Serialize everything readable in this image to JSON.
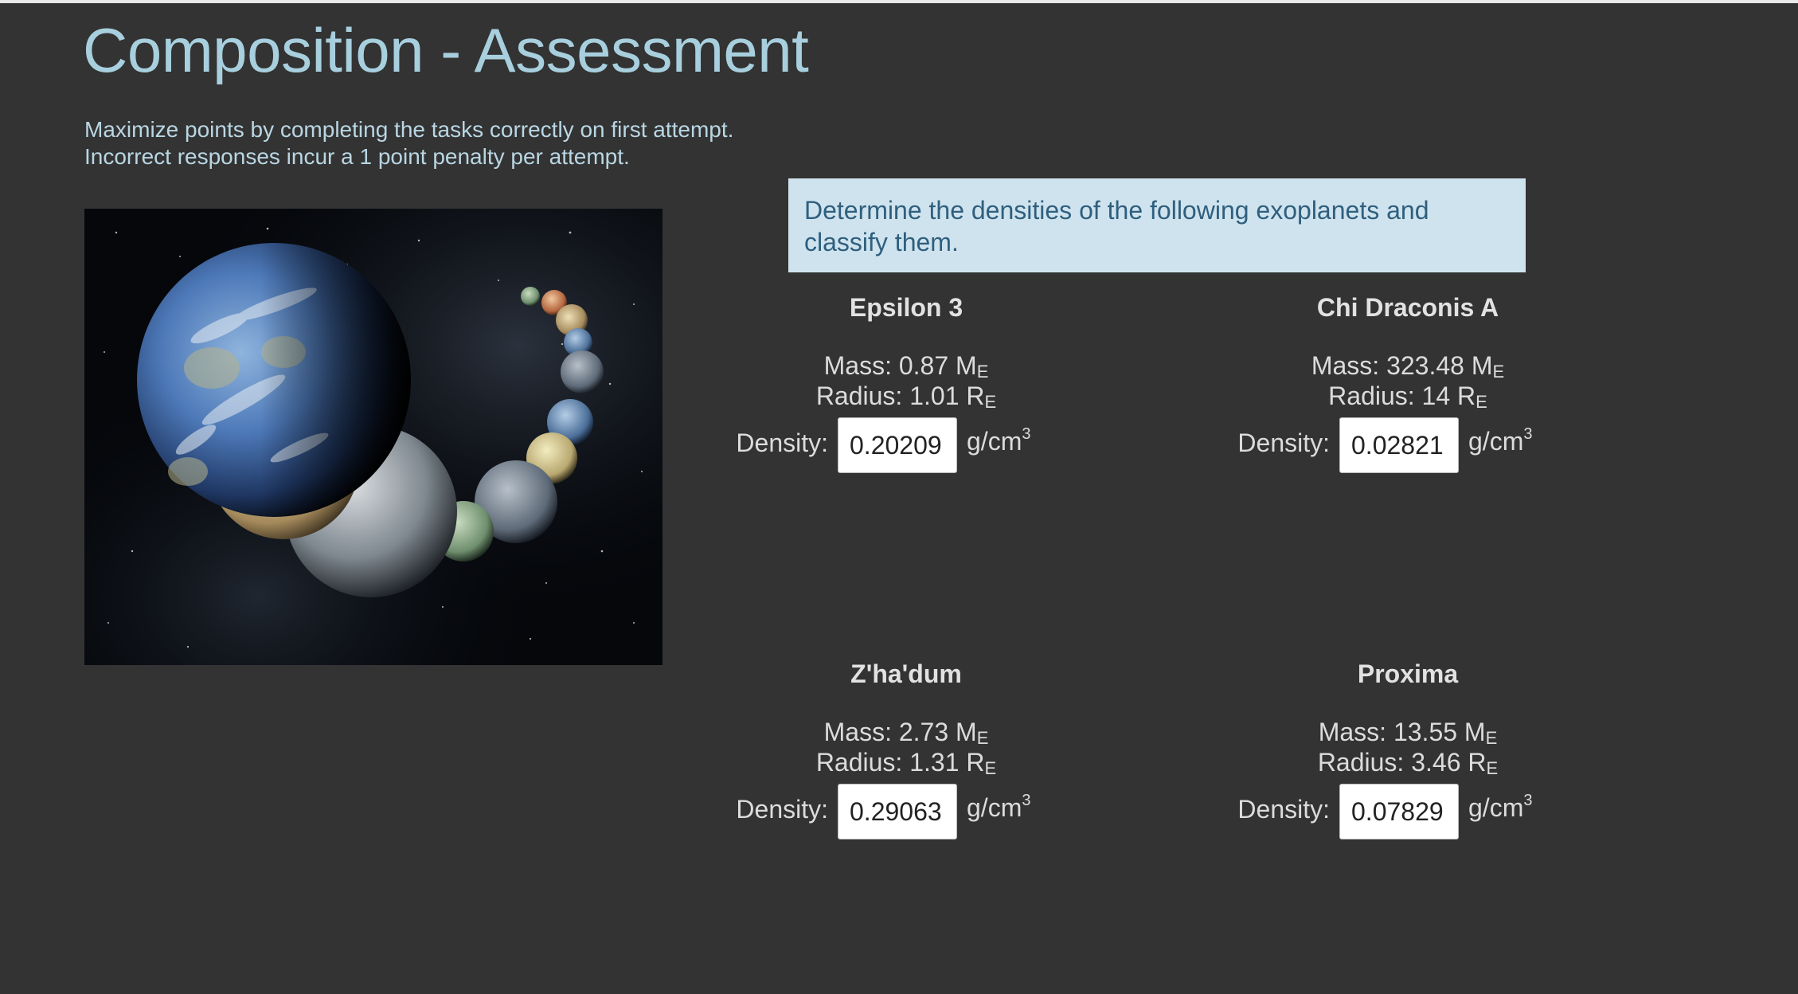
{
  "page": {
    "title": "Composition - Assessment",
    "instructions": [
      "Maximize points by completing the tasks correctly on first attempt.",
      "Incorrect responses incur a 1 point penalty per attempt."
    ]
  },
  "prompt": "Determine the densities of the following exoplanets and classify them.",
  "labels": {
    "mass": "Mass:",
    "radius": "Radius:",
    "density": "Density:",
    "unit_base": "g/cm",
    "unit_exp": "3",
    "mass_sub": "E",
    "radius_sub": "E",
    "mass_unit": "M",
    "radius_unit": "R"
  },
  "planets": [
    {
      "name": "Epsilon 3",
      "mass": "0.87",
      "radius": "1.01",
      "density_value": "0.20209"
    },
    {
      "name": "Chi Draconis A",
      "mass": "323.48",
      "radius": "14",
      "density_value": "0.02821"
    },
    {
      "name": "Z'ha'dum",
      "mass": "2.73",
      "radius": "1.31",
      "density_value": "0.29063"
    },
    {
      "name": "Proxima",
      "mass": "13.55",
      "radius": "3.46",
      "density_value": "0.07829"
    }
  ],
  "colors": {
    "background": "#333333",
    "title": "#a8cfde",
    "prompt_bg": "#cfe3ee",
    "prompt_text": "#2f5f7e"
  },
  "icons": {
    "hero_image": "exoplanet-lineup-illustration"
  }
}
